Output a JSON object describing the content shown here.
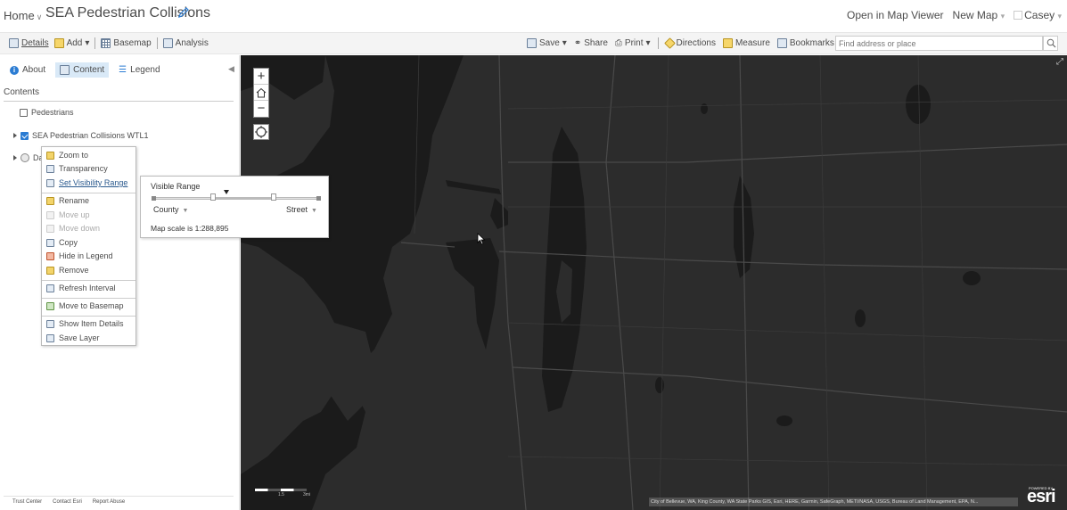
{
  "header": {
    "home": "Home",
    "home_caret": "∨",
    "title": "SEA Pedestrian Collisions",
    "links": [
      "Open in Map Viewer",
      "New Map",
      "Casey"
    ]
  },
  "toolbar": {
    "details": "Details",
    "add": "Add",
    "basemap": "Basemap",
    "analysis": "Analysis",
    "save": "Save",
    "share": "Share",
    "print": "Print",
    "directions": "Directions",
    "measure": "Measure",
    "bookmarks": "Bookmarks",
    "search_placeholder": "Find address or place"
  },
  "panel": {
    "tabs": [
      "About",
      "Content",
      "Legend"
    ],
    "contents_label": "Contents",
    "layers": [
      "Pedestrians",
      "SEA Pedestrian Collisions WTL1",
      "Da"
    ],
    "footer": [
      "Trust Center",
      "Contact Esri",
      "Report Abuse"
    ]
  },
  "context_menu": {
    "items": [
      "Zoom to",
      "Transparency",
      "Set Visibility Range",
      "Rename",
      "Move up",
      "Move down",
      "Copy",
      "Hide in Legend",
      "Remove",
      "Refresh Interval",
      "Move to Basemap",
      "Show Item Details",
      "Save Layer"
    ]
  },
  "visible_range": {
    "title": "Visible Range",
    "min_label": "County",
    "max_label": "Street",
    "scale_text": "Map scale is 1:288,895"
  },
  "map": {
    "attribution": "City of Bellevue, WA, King County, WA State Parks GIS, Esri, HERE, Garmin, SafeGraph, METI/NASA, USGS, Bureau of Land Management, EPA, N...",
    "powered_by": "POWERED BY",
    "esri_logo": "esri",
    "zoom_in": "+",
    "zoom_out": "−",
    "scale_labels": [
      "1.5",
      "3mi"
    ]
  },
  "colors": {
    "accent": "#2b7cd3",
    "map_land": "#2c2c2c",
    "map_water": "#1b1b1b"
  }
}
